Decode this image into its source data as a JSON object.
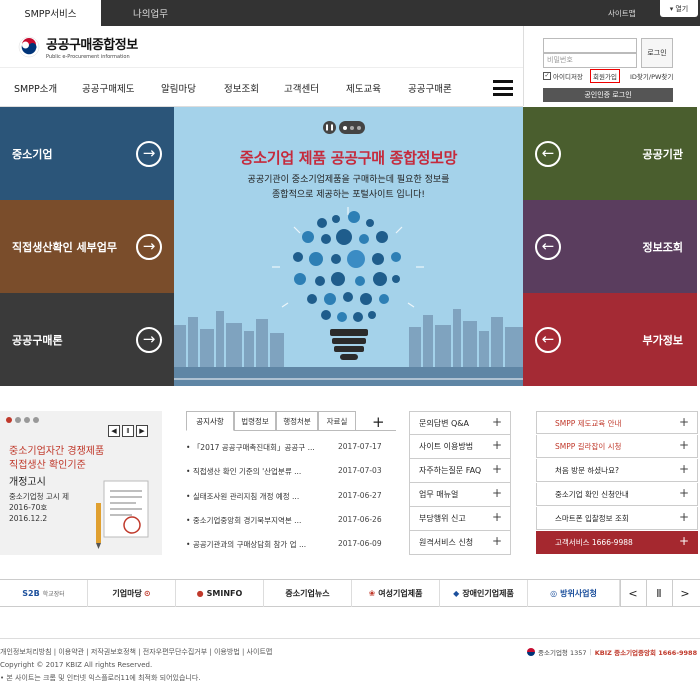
{
  "top_bar": {
    "tabs": [
      "SMPP서비스",
      "나의업무"
    ],
    "sitemap": "사이트맵",
    "open_label": "열기"
  },
  "logo": {
    "title": "공공구매종합정보",
    "subtitle": "Public e-Procurement information"
  },
  "login": {
    "id_placeholder": "",
    "pw_placeholder": "비밀번호",
    "login_button": "로그인",
    "save_id": "아이디저장",
    "join": "회원가입",
    "find": "ID찾기/PW찾기",
    "cert_login": "공인인증 로그인"
  },
  "nav": {
    "items": [
      "SMPP소개",
      "공공구매제도",
      "알림마당",
      "정보조회",
      "고객센터",
      "제도교육",
      "공공구매론"
    ]
  },
  "left_panels": [
    {
      "label": "중소기업",
      "color": "#2b5579"
    },
    {
      "label": "직접생산확인 세부업무",
      "color": "#7a4d2b"
    },
    {
      "label": "공공구매론",
      "color": "#3a3a3a"
    }
  ],
  "right_panels": [
    {
      "label": "공공기관",
      "color": "#4a5e2e"
    },
    {
      "label": "정보조회",
      "color": "#5a3d5e"
    },
    {
      "label": "부가정보",
      "color": "#a42a34"
    }
  ],
  "hero": {
    "title": "중소기업 제품 공공구매 종합정보망",
    "desc_line1": "공공기관이 중소기업제품을 구매하는데 필요한 정보를",
    "desc_line2": "종합적으로 제공하는 포털사이트 입니다!",
    "bg_color": "#a4d2ea",
    "title_color": "#c52a3c"
  },
  "promo": {
    "title_line1": "중소기업자간 경쟁제품",
    "title_line2": "직접생산 확인기준",
    "title_line3": "개정고시",
    "sub_line1": "중소기업청 고시 제2016-70호",
    "sub_line2": "2016.12.2",
    "ctrl": [
      "◀",
      "Ⅱ",
      "▶"
    ]
  },
  "notice": {
    "tabs": [
      "공지사항",
      "법령정보",
      "행정처분",
      "자료실"
    ],
    "more": "+",
    "items": [
      {
        "title": "「2017 공공구매촉진대회」공공구 ...",
        "date": "2017-07-17"
      },
      {
        "title": "직접생산 확인 기준의 '산업분류 ...",
        "date": "2017-07-03"
      },
      {
        "title": "실태조사원 관리지침 개정 예정 ...",
        "date": "2017-06-27"
      },
      {
        "title": "중소기업중앙회 경기북부지역본 ...",
        "date": "2017-06-26"
      },
      {
        "title": "공공기관과의 구매상담회 참가 업 ...",
        "date": "2017-06-09"
      }
    ]
  },
  "quick_links": {
    "items": [
      "문의답변 Q&A",
      "사이트 이용방법",
      "자주하는질문 FAQ",
      "업무 매뉴얼",
      "부당행위 신고",
      "원격서비스 신청"
    ],
    "plus": "+"
  },
  "right_links": {
    "items": [
      {
        "label": "SMPP 제도교육 안내",
        "style": "red"
      },
      {
        "label": "SMPP 길라잡이 시청",
        "style": "red"
      },
      {
        "label": "처음 방문 하셨나요?",
        "style": "normal"
      },
      {
        "label": "중소기업 확인 신청안내",
        "style": "normal"
      },
      {
        "label": "스마트폰 입찰정보 조회",
        "style": "normal"
      },
      {
        "label": "고객서비스 1666-9988",
        "style": "tel"
      }
    ],
    "plus": "+"
  },
  "banners": {
    "items": [
      "S2B",
      "기업마당",
      "SMINFO",
      "중소기업뉴스",
      "여성기업제품",
      "장애인기업제품",
      "방위사업청"
    ],
    "s2b_sub": "학교장터",
    "controls": [
      "<",
      "Ⅱ",
      ">"
    ]
  },
  "footer": {
    "links": "개인정보처리방침  |  이용약관  |  저작권보호정책  |  전자우편무단수집거부  |  이용방법  |  사이트맵",
    "copyright": "Copyright © 2017 KBIZ All rights Reserved.",
    "browser_note": "• 본 사이트는 크롬 및 인터넷 익스플로러11에 최적화 되어있습니다.",
    "right_text1": "중소기업청 1357",
    "right_text2": "KBIZ 중소기업중앙회 1666-9988"
  }
}
